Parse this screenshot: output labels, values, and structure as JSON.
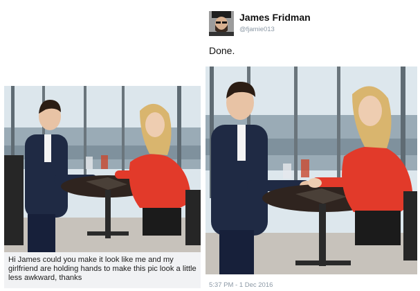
{
  "request_post": {
    "caption": "Hi James could you make it look like me and my girlfriend are holding hands to make this pic look a little less awkward, thanks"
  },
  "reply_post": {
    "author_name": "James Fridman",
    "author_handle": "@fjamie013",
    "text": "Done.",
    "timestamp": "5:37 PM - 1 Dec 2016"
  },
  "colors": {
    "window_sky": "#d9e3ea",
    "city": "#8a9aa6",
    "suit": "#1f2a44",
    "dress": "#e23a2a",
    "table": "#2f241f",
    "hair_man": "#2b1d14",
    "hair_woman": "#d9b56e",
    "skin": "#e8c3a5"
  },
  "icons": {
    "avatar": "bearded-man-with-cap-avatar"
  }
}
